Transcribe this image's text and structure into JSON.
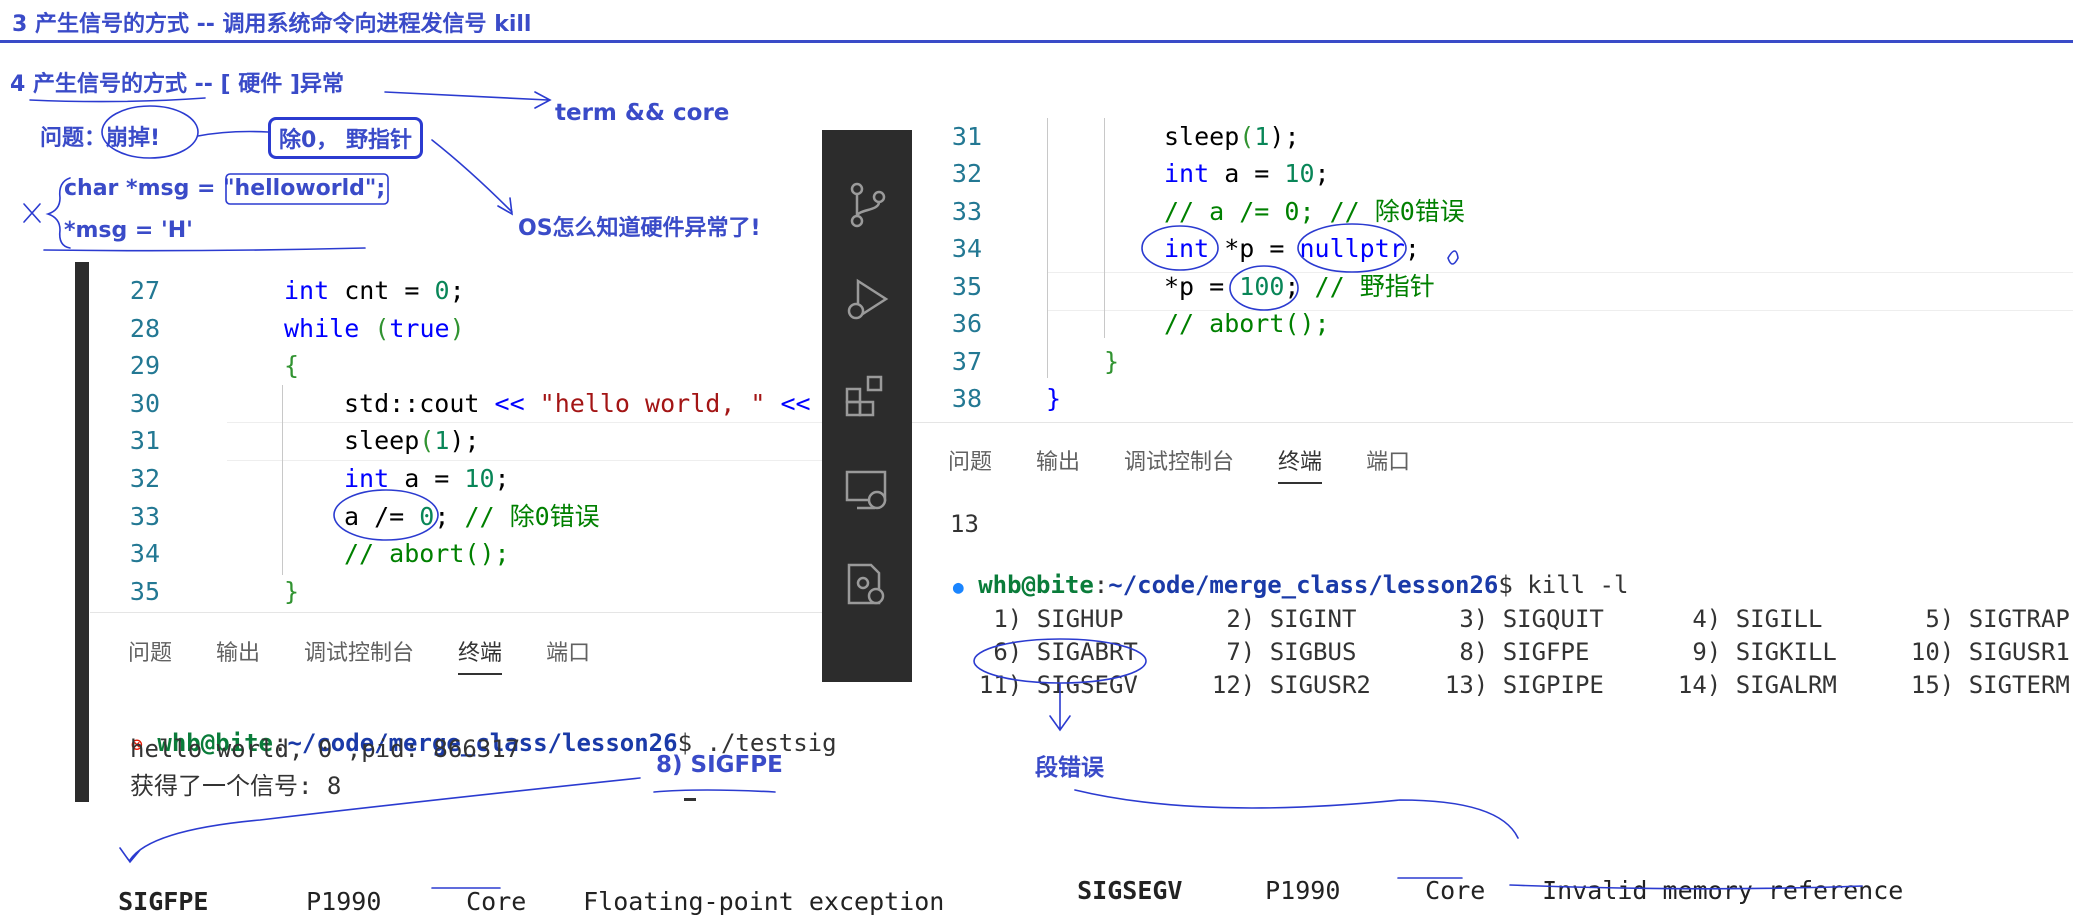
{
  "header": {
    "line3": "3 产生信号的方式 -- 调用系统命令向进程发信号 kill",
    "line4_prefix": "4 产生信号的方式 -- [ ",
    "line4_hw": "硬件",
    "line4_suffix": " ]异常"
  },
  "notes": {
    "term_core": "term && core",
    "question_label": "问题：",
    "question_value": "崩掉!",
    "div0": "除0， 野指针",
    "char_msg_prefix": "char *msg = ",
    "char_msg_value": "\"helloworld\"",
    "char_msg_suffix": ";",
    "msg_assign": "*msg = 'H'",
    "os_question": "OS怎么知道硬件异常了!",
    "sigfpe_label": "8) SIGFPE",
    "segfault_label": "段错误"
  },
  "left_editor": {
    "lines": [
      {
        "n": "27",
        "code": "int cnt = 0;"
      },
      {
        "n": "28",
        "code": "while (true)"
      },
      {
        "n": "29",
        "code": "{"
      },
      {
        "n": "30",
        "code": "std::cout << \"hello world, \" <<"
      },
      {
        "n": "31",
        "code": "sleep(1);"
      },
      {
        "n": "32",
        "code": "int a = 10;"
      },
      {
        "n": "33",
        "code": "a /= 0; // 除0错误"
      },
      {
        "n": "34",
        "code": "// abort();"
      },
      {
        "n": "35",
        "code": "}"
      }
    ],
    "ln27": "27",
    "ln28": "28",
    "ln29": "29",
    "ln30": "30",
    "ln31": "31",
    "ln32": "32",
    "ln33": "33",
    "ln34": "34",
    "ln35": "35",
    "c27_kw": "int",
    "c27_rest": " cnt = ",
    "c27_num": "0",
    "c27_end": ";",
    "c28_kw": "while",
    "c28_p1": " (",
    "c28_true": "true",
    "c28_p2": ")",
    "c29": "{",
    "c30_a": "std::cout ",
    "c30_op": "<<",
    "c30_str": " \"hello world, \"",
    "c30_op2": " <<",
    "c31_a": "sleep",
    "c31_p": "(",
    "c31_num": "1",
    "c31_e": ");",
    "c32_kw": "int",
    "c32_rest": " a = ",
    "c32_num": "10",
    "c32_e": ";",
    "c33_a": "a /= ",
    "c33_num": "0",
    "c33_e": ";",
    "c33_cm": " // 除0错误",
    "c34_cm": "// abort();",
    "c35": "}"
  },
  "left_panel": {
    "tabs": [
      "问题",
      "输出",
      "调试控制台",
      "终端",
      "端口"
    ],
    "tab0": "问题",
    "tab1": "输出",
    "tab2": "调试控制台",
    "tab3": "终端",
    "tab4": "端口",
    "prompt_user": "whb@bite",
    "prompt_sep": ":",
    "prompt_path": "~/code/merge_class/lesson26",
    "prompt_cmd": "$ ./testsig",
    "out1": "hello world, 0 ,pid: 866317",
    "out2": "获得了一个信号: 8"
  },
  "right_editor": {
    "ln31": "31",
    "ln32": "32",
    "ln33": "33",
    "ln34": "34",
    "ln35": "35",
    "ln36": "36",
    "ln37": "37",
    "ln38": "38",
    "c31_a": "sleep",
    "c31_p": "(",
    "c31_num": "1",
    "c31_e": ");",
    "c32_kw": "int",
    "c32_rest": " a = ",
    "c32_num": "10",
    "c32_e": ";",
    "c33_cm": "// a /= 0; // 除0错误",
    "c34_kw": "int",
    "c34_rest": " *p = ",
    "c34_null": "nullptr",
    "c34_e": ";",
    "c35_a": "*p = ",
    "c35_num": "100",
    "c35_e": ";",
    "c35_cm": " // 野指针",
    "c36_cm": "// abort();",
    "c37": "}",
    "c38": "}"
  },
  "right_panel": {
    "tab0": "问题",
    "tab1": "输出",
    "tab2": "调试控制台",
    "tab3": "终端",
    "tab4": "端口",
    "prev_out": "13",
    "prompt_user": "whb@bite",
    "prompt_sep": ":",
    "prompt_path": "~/code/merge_class/lesson26",
    "prompt_cmd": "$ kill -l",
    "row1": [
      " 1) SIGHUP",
      " 2) SIGINT",
      " 3) SIGQUIT",
      " 4) SIGILL",
      " 5) SIGTRAP"
    ],
    "row2": [
      " 6) SIGABRT",
      " 7) SIGBUS",
      " 8) SIGFPE",
      " 9) SIGKILL",
      "10) SIGUSR1"
    ],
    "row3": [
      "11) SIGSEGV",
      "12) SIGUSR2",
      "13) SIGPIPE",
      "14) SIGALRM",
      "15) SIGTERM"
    ]
  },
  "man_table": {
    "left": {
      "name": "SIGFPE",
      "std": "P1990",
      "action": "Core",
      "desc": "Floating-point exception"
    },
    "right": {
      "name": "SIGSEGV",
      "std": "P1990",
      "action": "Core",
      "desc": "Invalid memory reference"
    }
  },
  "activity_bar_icons": [
    "source-control-icon",
    "run-debug-icon",
    "extensions-icon",
    "remote-explorer-icon",
    "settings-debug-icon"
  ],
  "colors": {
    "annotation_blue": "#3a4bc8",
    "pen_blue": "#2b3bd0",
    "activity_bar": "#2c2c2c",
    "keyword": "#0000ff",
    "number": "#098658",
    "comment": "#008000",
    "string": "#a31515"
  }
}
